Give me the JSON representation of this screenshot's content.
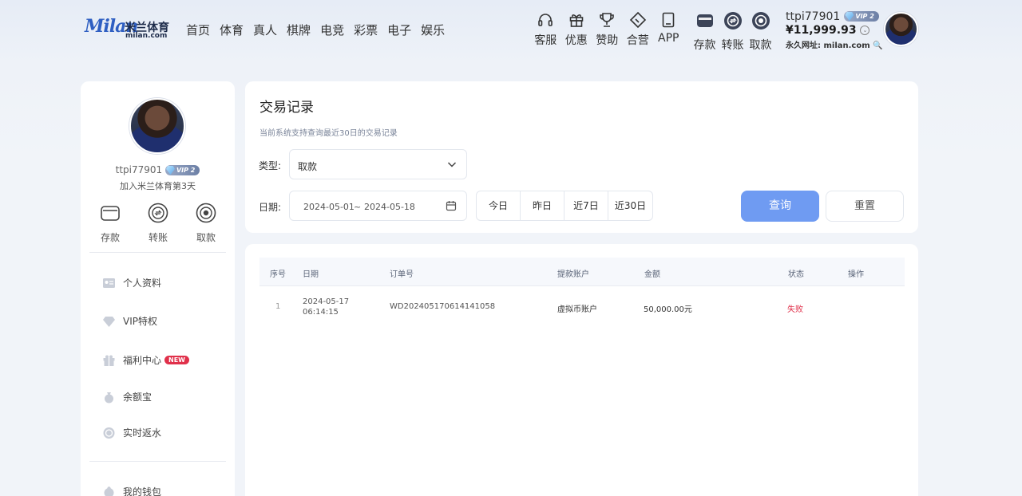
{
  "header": {
    "logo_script": "Milan",
    "logo_cn": "米兰体育",
    "logo_domain": "milan.com",
    "nav": [
      "首页",
      "体育",
      "真人",
      "棋牌",
      "电竞",
      "彩票",
      "电子",
      "娱乐"
    ],
    "tools": [
      {
        "label": "客服",
        "icon": "headset-icon"
      },
      {
        "label": "优惠",
        "icon": "gift-icon"
      },
      {
        "label": "赞助",
        "icon": "trophy-icon"
      },
      {
        "label": "合营",
        "icon": "ticket-icon"
      },
      {
        "label": "APP",
        "icon": "tablet-icon"
      }
    ],
    "wallet_tools": [
      {
        "label": "存款",
        "icon": "wallet-icon"
      },
      {
        "label": "转账",
        "icon": "transfer-icon"
      },
      {
        "label": "取款",
        "icon": "withdraw-icon"
      }
    ],
    "username": "ttpi77901",
    "vip": "VIP 2",
    "balance": "¥11,999.93",
    "permanent_url": "永久网址: milan.com"
  },
  "sidebar": {
    "username": "ttpi77901",
    "vip": "VIP 2",
    "joined": "加入米兰体育第3天",
    "actions": [
      {
        "label": "存款"
      },
      {
        "label": "转账"
      },
      {
        "label": "取款"
      }
    ],
    "menu": [
      {
        "label": "个人资料",
        "icon": "id-card-icon"
      },
      {
        "label": "VIP特权",
        "icon": "diamond-icon"
      },
      {
        "label": "福利中心",
        "icon": "gift-icon",
        "badge": "NEW"
      },
      {
        "label": "余额宝",
        "icon": "money-bag-icon"
      },
      {
        "label": "实时返水",
        "icon": "rebate-icon"
      },
      {
        "label": "我的钱包",
        "icon": "wallet-icon"
      }
    ]
  },
  "filters": {
    "title": "交易记录",
    "notice": "当前系统支持查询最近30日的交易记录",
    "type_label": "类型:",
    "type_value": "取款",
    "date_label": "日期:",
    "date_start": "2024-05-01",
    "date_sep": "~",
    "date_end": "2024-05-18",
    "quick": [
      "今日",
      "昨日",
      "近7日",
      "近30日"
    ],
    "query": "查询",
    "reset": "重置"
  },
  "table": {
    "columns": [
      "序号",
      "日期",
      "订单号",
      "提款账户",
      "金额",
      "状态",
      "操作"
    ],
    "rows": [
      {
        "index": "1",
        "date": "2024-05-17",
        "time": "06:14:15",
        "order": "WD202405170614141058",
        "account": "虚拟币账户",
        "amount": "50,000.00元",
        "status": "失败",
        "status_color": "#e0304a",
        "action": ""
      }
    ]
  },
  "colors": {
    "accent": "#6f9bf2",
    "fail": "#e0304a"
  }
}
